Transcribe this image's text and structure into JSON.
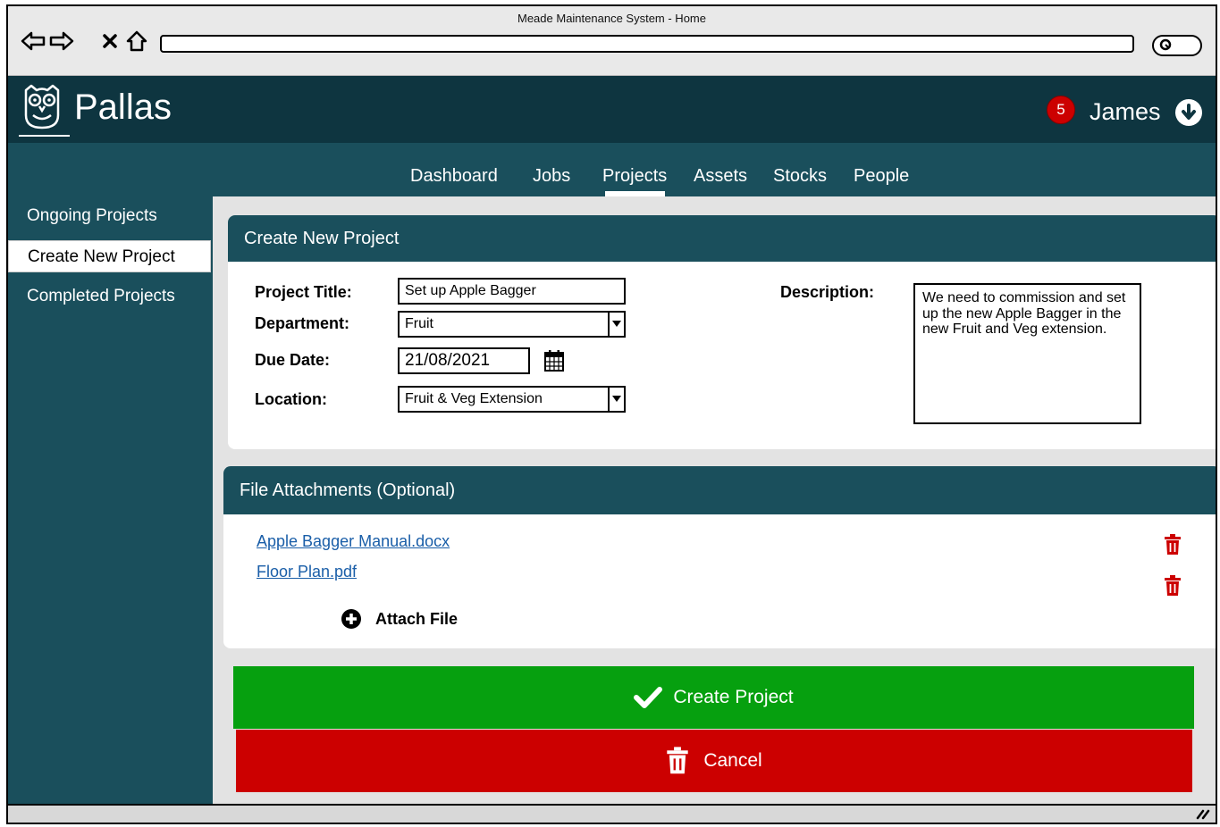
{
  "browser": {
    "title": "Meade Maintenance System - Home"
  },
  "app": {
    "name": "Pallas",
    "notification_count": "5",
    "user_name": "James"
  },
  "nav": {
    "items": [
      {
        "label": "Dashboard"
      },
      {
        "label": "Jobs"
      },
      {
        "label": "Projects"
      },
      {
        "label": "Assets"
      },
      {
        "label": "Stocks"
      },
      {
        "label": "People"
      }
    ],
    "active": "Projects"
  },
  "sidebar": {
    "items": [
      {
        "label": "Ongoing Projects"
      },
      {
        "label": "Create New Project"
      },
      {
        "label": "Completed Projects"
      }
    ],
    "active": "Create New Project"
  },
  "form": {
    "header": "Create New Project",
    "title_label": "Project Title:",
    "title_value": "Set up Apple Bagger",
    "department_label": "Department:",
    "department_value": "Fruit",
    "due_date_label": "Due Date:",
    "due_date_value": "21/08/2021",
    "location_label": "Location:",
    "location_value": "Fruit & Veg Extension",
    "description_label": "Description:",
    "description_value": "We need to commission and set up the new Apple Bagger in the new Fruit and Veg extension."
  },
  "attachments": {
    "header": "File Attachments (Optional)",
    "files": [
      {
        "name": "Apple Bagger Manual.docx"
      },
      {
        "name": "Floor Plan.pdf"
      }
    ],
    "attach_label": "Attach File"
  },
  "actions": {
    "create_label": "Create Project",
    "cancel_label": "Cancel"
  },
  "colors": {
    "header_bg": "#0e3540",
    "main_bg": "#1a4f5c",
    "create_green": "#06a00f",
    "cancel_red": "#cc0000",
    "link_blue": "#1a5ea8"
  }
}
